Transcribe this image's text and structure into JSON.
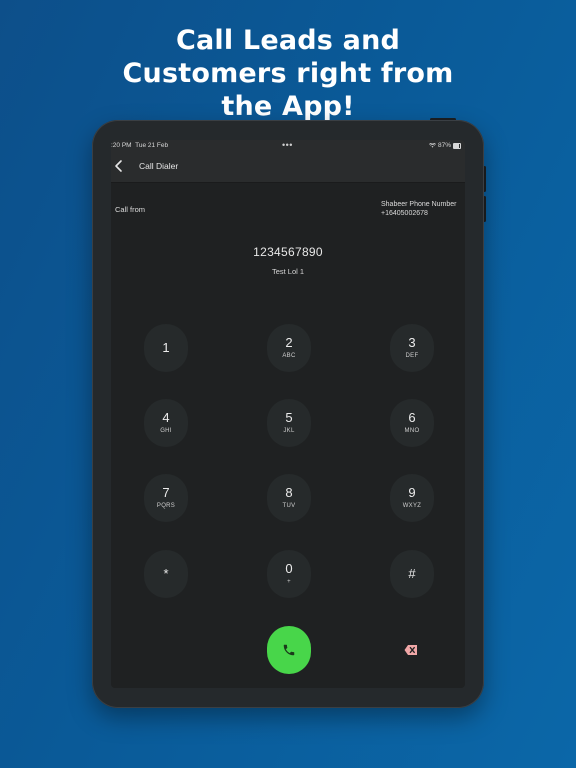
{
  "headline": {
    "line1": "Call Leads and",
    "line2": "Customers right from",
    "line3": "the App!"
  },
  "status_bar": {
    "time": ":20 PM",
    "date": "Tue 21 Feb",
    "dots": "•••",
    "battery": "87%",
    "icons": [
      "wifi-icon",
      "battery-icon"
    ]
  },
  "nav": {
    "back_icon": "chevron-left-icon",
    "title": "Call Dialer"
  },
  "dialer": {
    "call_from_label": "Call from",
    "from_name": "Shabeer Phone Number",
    "from_number": "+16405002678",
    "dialed_number": "1234567890",
    "contact_name": "Test Lol 1"
  },
  "keypad": {
    "k1": {
      "digit": "1",
      "letters": ""
    },
    "k2": {
      "digit": "2",
      "letters": "ABC"
    },
    "k3": {
      "digit": "3",
      "letters": "DEF"
    },
    "k4": {
      "digit": "4",
      "letters": "GHI"
    },
    "k5": {
      "digit": "5",
      "letters": "JKL"
    },
    "k6": {
      "digit": "6",
      "letters": "MNO"
    },
    "k7": {
      "digit": "7",
      "letters": "PQRS"
    },
    "k8": {
      "digit": "8",
      "letters": "TUV"
    },
    "k9": {
      "digit": "9",
      "letters": "WXYZ"
    },
    "kstar": {
      "digit": "*",
      "letters": ""
    },
    "k0": {
      "digit": "0",
      "letters": "+"
    },
    "khash": {
      "digit": "#",
      "letters": ""
    }
  },
  "actions": {
    "call_icon": "phone-icon",
    "backspace_icon": "backspace-icon"
  },
  "colors": {
    "background": "#0b5a98",
    "screen": "#1f2122",
    "key": "#262a2b",
    "call_button": "#48d64a",
    "backspace": "#f0a7a7"
  }
}
